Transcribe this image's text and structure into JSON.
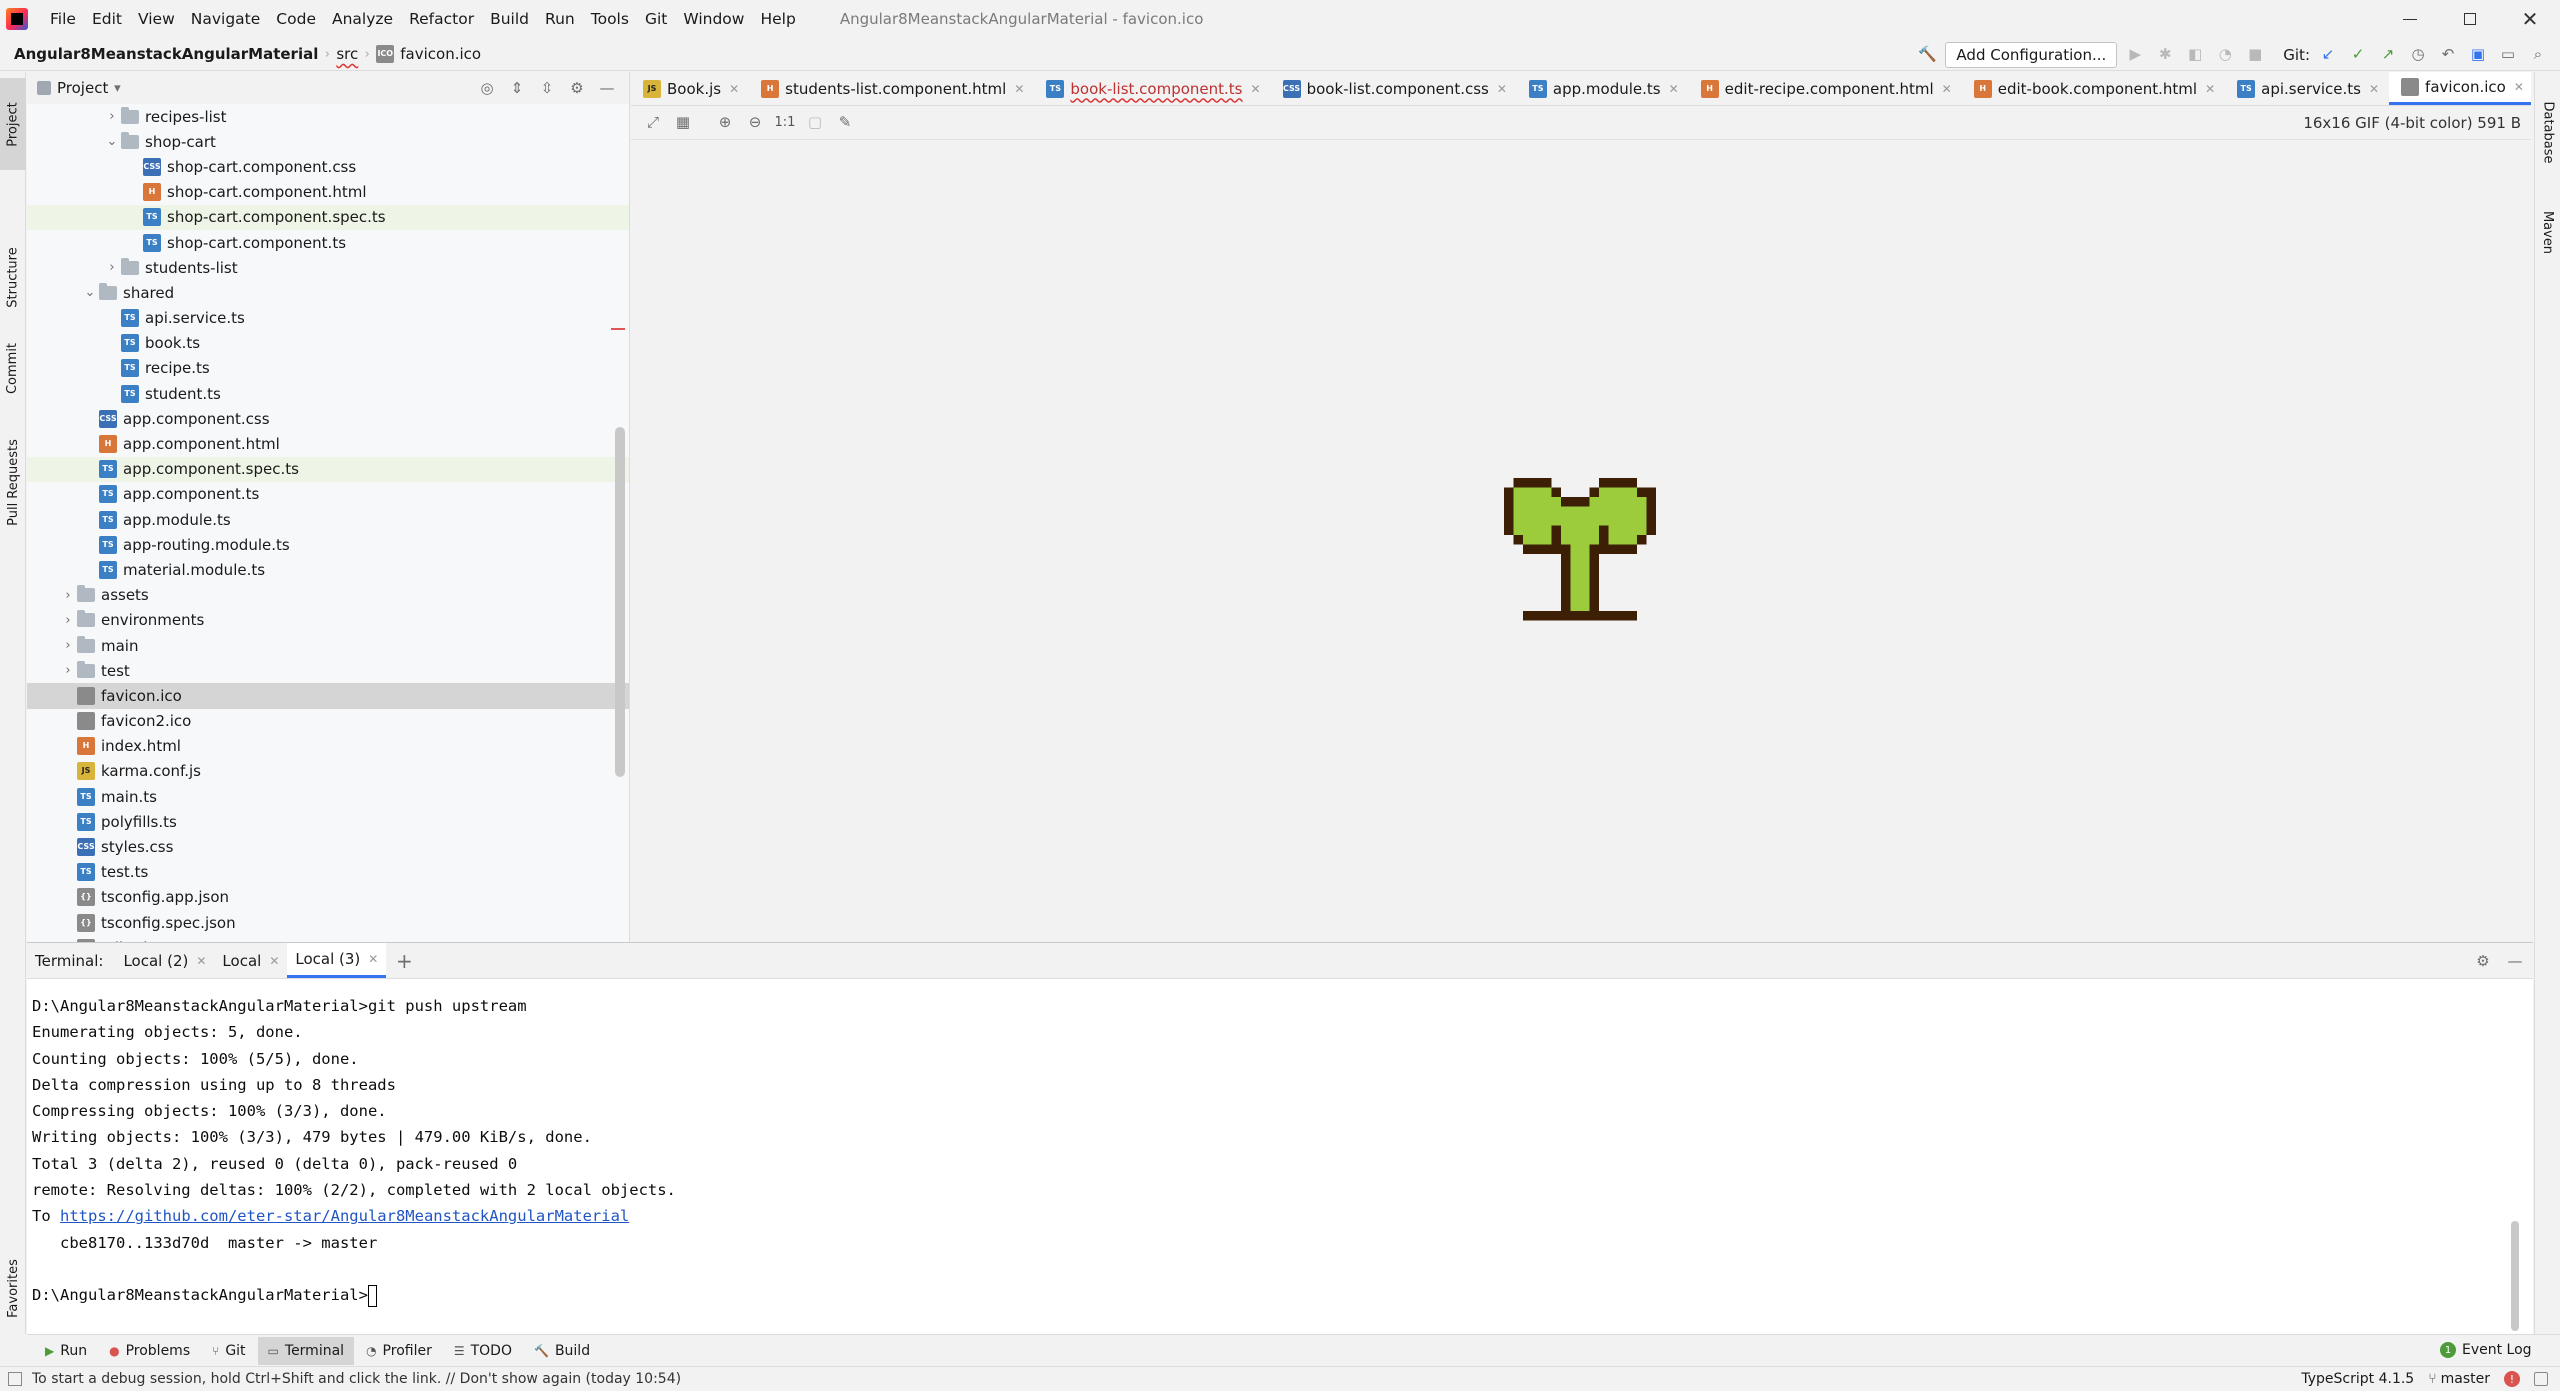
{
  "menu": {
    "items": [
      "File",
      "Edit",
      "View",
      "Navigate",
      "Code",
      "Analyze",
      "Refactor",
      "Build",
      "Run",
      "Tools",
      "Git",
      "Window",
      "Help"
    ],
    "window_title": "Angular8MeanstackAngularMaterial - favicon.ico"
  },
  "breadcrumb": {
    "project": "Angular8MeanstackAngularMaterial",
    "folder": "src",
    "file": "favicon.ico"
  },
  "toolbar": {
    "add_config": "Add Configuration...",
    "git_label": "Git:"
  },
  "left_stripe": {
    "project": "Project",
    "structure": "Structure",
    "commit": "Commit",
    "pull_requests": "Pull Requests",
    "favorites": "Favorites"
  },
  "right_stripe": {
    "database": "Database",
    "maven": "Maven"
  },
  "project_panel": {
    "title": "Project"
  },
  "tree": [
    {
      "label": "recipes-list",
      "kind": "folder",
      "expanded": false
    },
    {
      "label": "shop-cart",
      "kind": "folder",
      "expanded": true
    },
    {
      "label": "shop-cart.component.css",
      "kind": "css"
    },
    {
      "label": "shop-cart.component.html",
      "kind": "html"
    },
    {
      "label": "shop-cart.component.spec.ts",
      "kind": "ts"
    },
    {
      "label": "shop-cart.component.ts",
      "kind": "ts"
    },
    {
      "label": "students-list",
      "kind": "folder",
      "expanded": false
    },
    {
      "label": "shared",
      "kind": "folder",
      "expanded": true
    },
    {
      "label": "api.service.ts",
      "kind": "ts"
    },
    {
      "label": "book.ts",
      "kind": "ts"
    },
    {
      "label": "recipe.ts",
      "kind": "ts"
    },
    {
      "label": "student.ts",
      "kind": "ts"
    },
    {
      "label": "app.component.css",
      "kind": "css"
    },
    {
      "label": "app.component.html",
      "kind": "html"
    },
    {
      "label": "app.component.spec.ts",
      "kind": "ts"
    },
    {
      "label": "app.component.ts",
      "kind": "ts"
    },
    {
      "label": "app.module.ts",
      "kind": "ts"
    },
    {
      "label": "app-routing.module.ts",
      "kind": "ts"
    },
    {
      "label": "material.module.ts",
      "kind": "ts"
    },
    {
      "label": "assets",
      "kind": "folder",
      "expanded": false
    },
    {
      "label": "environments",
      "kind": "folder",
      "expanded": false
    },
    {
      "label": "main",
      "kind": "folder",
      "expanded": false
    },
    {
      "label": "test",
      "kind": "folder",
      "expanded": false
    },
    {
      "label": "favicon.ico",
      "kind": "ico"
    },
    {
      "label": "favicon2.ico",
      "kind": "ico"
    },
    {
      "label": "index.html",
      "kind": "html"
    },
    {
      "label": "karma.conf.js",
      "kind": "js"
    },
    {
      "label": "main.ts",
      "kind": "ts"
    },
    {
      "label": "polyfills.ts",
      "kind": "ts"
    },
    {
      "label": "styles.css",
      "kind": "css"
    },
    {
      "label": "test.ts",
      "kind": "ts"
    },
    {
      "label": "tsconfig.app.json",
      "kind": "json"
    },
    {
      "label": "tsconfig.spec.json",
      "kind": "json"
    },
    {
      "label": "tslint.json",
      "kind": "json"
    }
  ],
  "editor_tabs": [
    {
      "label": "Book.js",
      "kind": "js"
    },
    {
      "label": "students-list.component.html",
      "kind": "html"
    },
    {
      "label": "book-list.component.ts",
      "kind": "ts"
    },
    {
      "label": "book-list.component.css",
      "kind": "css"
    },
    {
      "label": "app.module.ts",
      "kind": "ts"
    },
    {
      "label": "edit-recipe.component.html",
      "kind": "html"
    },
    {
      "label": "edit-book.component.html",
      "kind": "html"
    },
    {
      "label": "api.service.ts",
      "kind": "ts"
    },
    {
      "label": "favicon.ico",
      "kind": "ico"
    }
  ],
  "image_viewer": {
    "info": "16x16 GIF (4-bit color) 591 B",
    "zoom_actual": "1:1"
  },
  "terminal": {
    "label": "Terminal:",
    "tabs": [
      "Local (2)",
      "Local",
      "Local (3)"
    ],
    "lines": [
      "D:\\Angular8MeanstackAngularMaterial>git push upstream",
      "Enumerating objects: 5, done.",
      "Counting objects: 100% (5/5), done.",
      "Delta compression using up to 8 threads",
      "Compressing objects: 100% (3/3), done.",
      "Writing objects: 100% (3/3), 479 bytes | 479.00 KiB/s, done.",
      "Total 3 (delta 2), reused 0 (delta 0), pack-reused 0",
      "remote: Resolving deltas: 100% (2/2), completed with 2 local objects."
    ],
    "to_prefix": "To ",
    "link": "https://github.com/eter-star/Angular8MeanstackAngularMaterial",
    "ref_line": "   cbe8170..133d70d  master -> master",
    "prompt": "D:\\Angular8MeanstackAngularMaterial>"
  },
  "bottom_tools": [
    "Run",
    "Problems",
    "Git",
    "Terminal",
    "Profiler",
    "TODO",
    "Build"
  ],
  "event_log": "Event Log",
  "status": {
    "message": "To start a debug session, hold Ctrl+Shift and click the link. // Don't show again (today 10:54)",
    "language": "TypeScript 4.1.5",
    "branch": "master"
  },
  "colors": {
    "accent": "#3574f0",
    "selected_row": "#d5d5d5",
    "modified_row": "#eef5e6",
    "leaf_green": "#9ccc3c",
    "trunk": "#4a2a0c"
  }
}
